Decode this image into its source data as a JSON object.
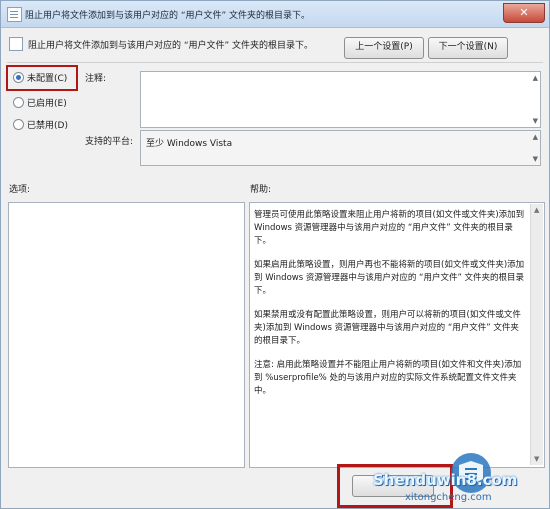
{
  "window": {
    "title": "阻止用户将文件添加到与该用户对应的 “用户文件” 文件夹的根目录下。",
    "close_glyph": "✕"
  },
  "header": {
    "text": "阻止用户将文件添加到与该用户对应的 “用户文件” 文件夹的根目录下。",
    "prev_button": "上一个设置(P)",
    "next_button": "下一个设置(N)"
  },
  "options": [
    {
      "label": "未配置(C)",
      "selected": true
    },
    {
      "label": "已启用(E)",
      "selected": false
    },
    {
      "label": "已禁用(D)",
      "selected": false
    }
  ],
  "comment": {
    "label": "注释:",
    "value": ""
  },
  "platform": {
    "label": "支持的平台:",
    "value": "至少 Windows Vista"
  },
  "sections": {
    "options_label": "选项:",
    "help_label": "帮助:"
  },
  "help": {
    "paragraphs": [
      "管理员可使用此策略设置来阻止用户将新的项目(如文件或文件夹)添加到 Windows 资源管理器中与该用户对应的 “用户文件” 文件夹的根目录下。",
      "如果启用此策略设置，则用户再也不能将新的项目(如文件或文件夹)添加到 Windows 资源管理器中与该用户对应的 “用户文件” 文件夹的根目录下。",
      "如果禁用或没有配置此策略设置，则用户可以将新的项目(如文件或文件夹)添加到 Windows 资源管理器中与该用户对应的 “用户文件” 文件夹的根目录下。",
      "注意: 启用此策略设置并不能阻止用户将新的项目(如文件和文件夹)添加到 %userprofile% 处的与该用户对应的实际文件系统配置文件文件夹中。"
    ]
  },
  "watermark": {
    "brand": "Shenduwin8.com",
    "url": "xitongcheng.com"
  },
  "colors": {
    "highlight": "#b01818",
    "radio_selected": "#3a6fc0"
  }
}
